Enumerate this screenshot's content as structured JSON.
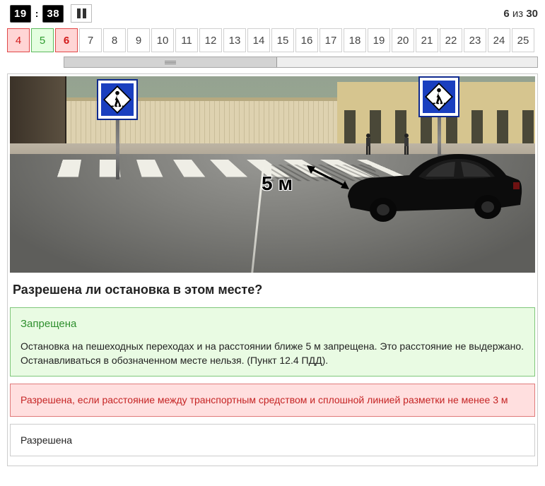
{
  "timer": {
    "minutes": "19",
    "seconds": "38"
  },
  "progress": {
    "current": "6",
    "sep": "из",
    "total": "30"
  },
  "nav": {
    "items": [
      {
        "n": "4",
        "state": "wrong"
      },
      {
        "n": "5",
        "state": "correct"
      },
      {
        "n": "6",
        "state": "wrong current"
      },
      {
        "n": "7"
      },
      {
        "n": "8"
      },
      {
        "n": "9"
      },
      {
        "n": "10"
      },
      {
        "n": "11"
      },
      {
        "n": "12"
      },
      {
        "n": "13"
      },
      {
        "n": "14"
      },
      {
        "n": "15"
      },
      {
        "n": "16"
      },
      {
        "n": "17"
      },
      {
        "n": "18"
      },
      {
        "n": "19"
      },
      {
        "n": "20"
      },
      {
        "n": "21"
      },
      {
        "n": "22"
      },
      {
        "n": "23"
      },
      {
        "n": "24"
      },
      {
        "n": "25"
      }
    ]
  },
  "scene": {
    "dim_label": "5 м"
  },
  "question": "Разрешена ли остановка в этом месте?",
  "answers": [
    {
      "title": "Запрещена",
      "state": "correct",
      "explanation": "Остановка на пешеходных переходах и на расстоянии ближе 5 м запрещена. Это расстояние не выдержано. Останавливаться в обозначенном месте нельзя. (Пункт 12.4 ПДД)."
    },
    {
      "title": "Разрешена, если расстояние между транспортным средством и сплошной линией разметки не менее 3 м",
      "state": "wrong"
    },
    {
      "title": "Разрешена",
      "state": "neutral"
    }
  ]
}
